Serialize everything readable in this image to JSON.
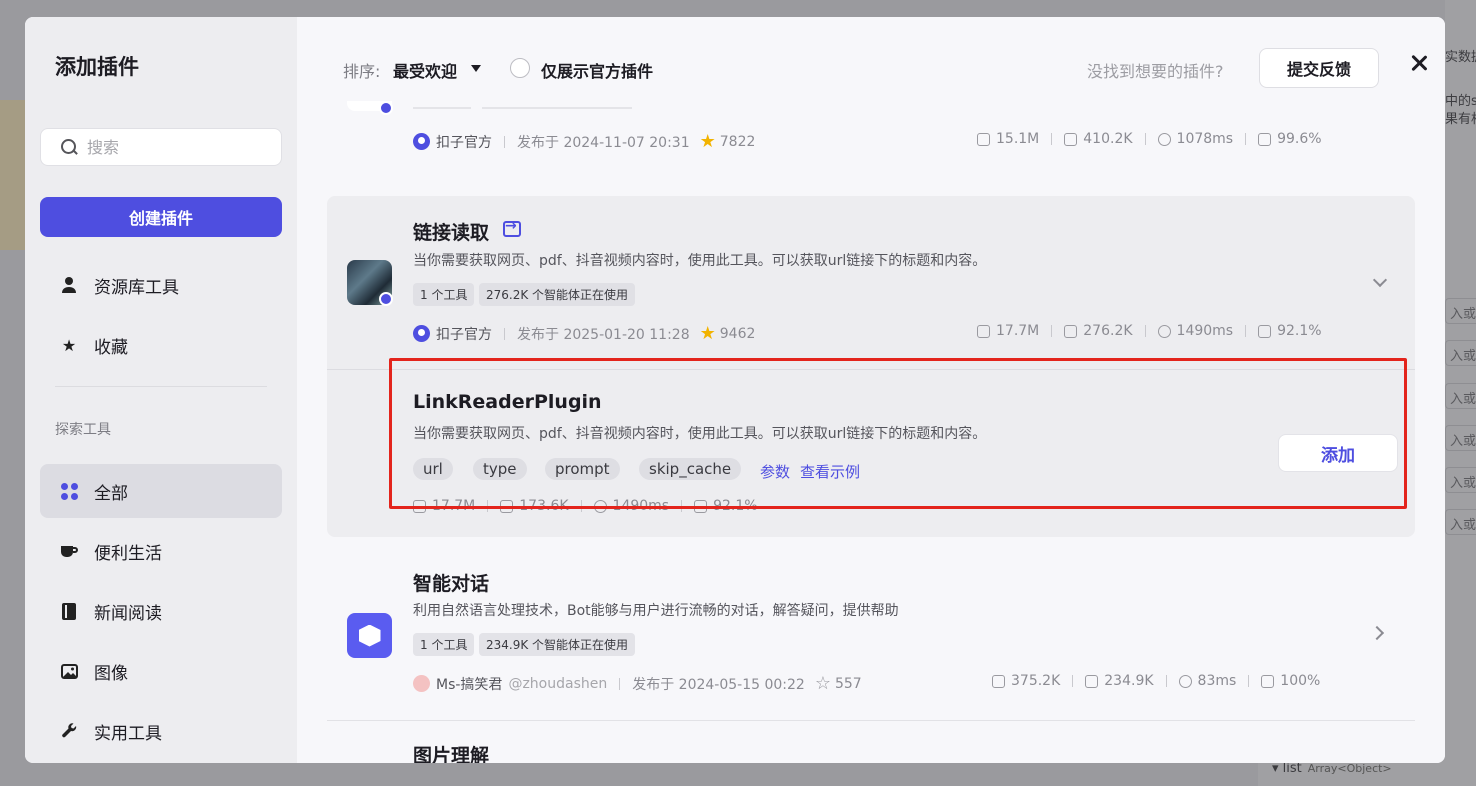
{
  "background": {
    "right_texts": [
      "实数据",
      "中的se",
      "果有相"
    ],
    "right_rows": [
      "入或",
      "入或",
      "入或",
      "入或",
      "入或",
      "入或",
      "入或"
    ],
    "bottom_field": "list",
    "bottom_type": "Array<Object>"
  },
  "modal": {
    "title": "添加插件",
    "search": {
      "placeholder": "搜索"
    },
    "create_button": "创建插件",
    "nav_top": [
      {
        "label": "资源库工具",
        "icon": "person-icon"
      },
      {
        "label": "收藏",
        "icon": "star-icon"
      }
    ],
    "explore_label": "探索工具",
    "nav_explore": [
      {
        "label": "全部",
        "icon": "grid-dots-icon",
        "active": true
      },
      {
        "label": "便利生活",
        "icon": "cup-icon"
      },
      {
        "label": "新闻阅读",
        "icon": "book-icon"
      },
      {
        "label": "图像",
        "icon": "image-icon"
      },
      {
        "label": "实用工具",
        "icon": "wrench-icon"
      }
    ],
    "header": {
      "sort_label": "排序:",
      "sort_value": "最受欢迎",
      "official_only_label": "仅展示官方插件",
      "not_found_text": "没找到想要的插件?",
      "feedback_button": "提交反馈"
    },
    "plugins": [
      {
        "org": "扣子官方",
        "published": "发布于 2024-11-07 20:31",
        "stars": "7822",
        "stats": {
          "calls": "15.1M",
          "bots": "410.2K",
          "latency": "1078ms",
          "success": "99.6%"
        }
      },
      {
        "title": "链接读取",
        "description": "当你需要获取网页、pdf、抖音视频内容时，使用此工具。可以获取url链接下的标题和内容。",
        "tags": [
          "1 个工具",
          "276.2K 个智能体正在使用"
        ],
        "org": "扣子官方",
        "published": "发布于 2025-01-20 11:28",
        "stars": "9462",
        "stats": {
          "calls": "17.7M",
          "bots": "276.2K",
          "latency": "1490ms",
          "success": "92.1%"
        },
        "tool": {
          "name": "LinkReaderPlugin",
          "description": "当你需要获取网页、pdf、抖音视频内容时，使用此工具。可以获取url链接下的标题和内容。",
          "params": [
            "url",
            "type",
            "prompt",
            "skip_cache"
          ],
          "params_link": "参数",
          "example_link": "查看示例",
          "add_button": "添加",
          "stats": {
            "calls": "17.7M",
            "bots": "173.6K",
            "latency": "1490ms",
            "success": "92.1%"
          }
        }
      },
      {
        "title": "智能对话",
        "description": "利用自然语言处理技术，Bot能够与用户进行流畅的对话，解答疑问，提供帮助",
        "tags": [
          "1 个工具",
          "234.9K 个智能体正在使用"
        ],
        "author": "Ms-搞笑君",
        "handle": "@zhoudashen",
        "published": "发布于 2024-05-15 00:22",
        "stars": "557",
        "stats": {
          "calls": "375.2K",
          "bots": "234.9K",
          "latency": "83ms",
          "success": "100%"
        }
      },
      {
        "title": "图片理解"
      }
    ]
  }
}
